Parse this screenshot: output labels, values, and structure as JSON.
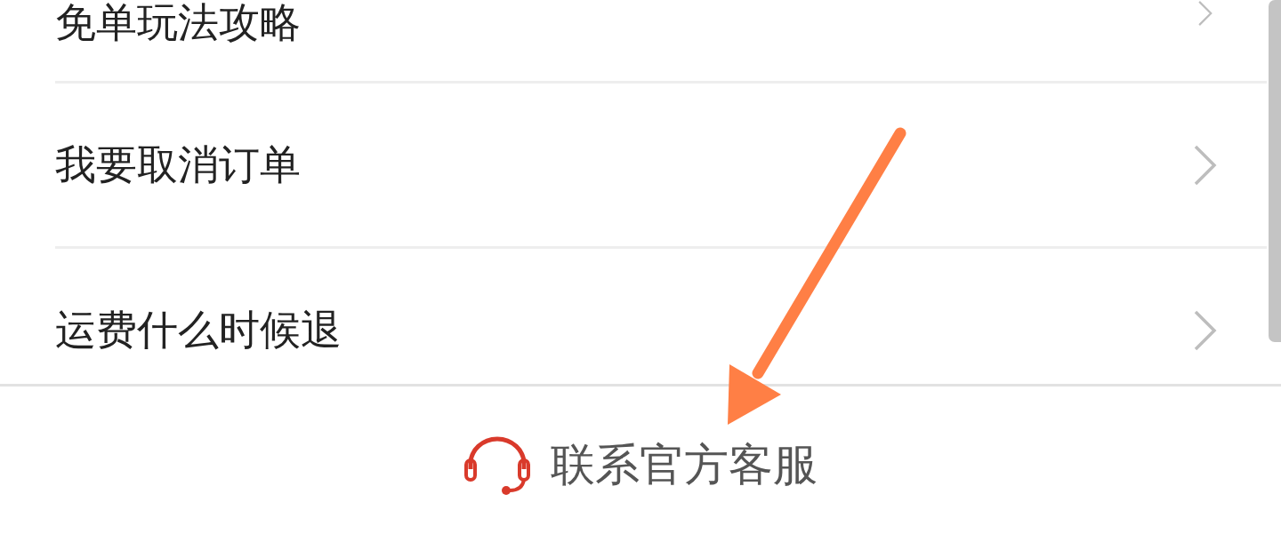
{
  "help_items": [
    {
      "label": "免单玩法攻略"
    },
    {
      "label": "我要取消订单"
    },
    {
      "label": "运费什么时候退"
    }
  ],
  "contact_button": {
    "label": "联系官方客服"
  }
}
